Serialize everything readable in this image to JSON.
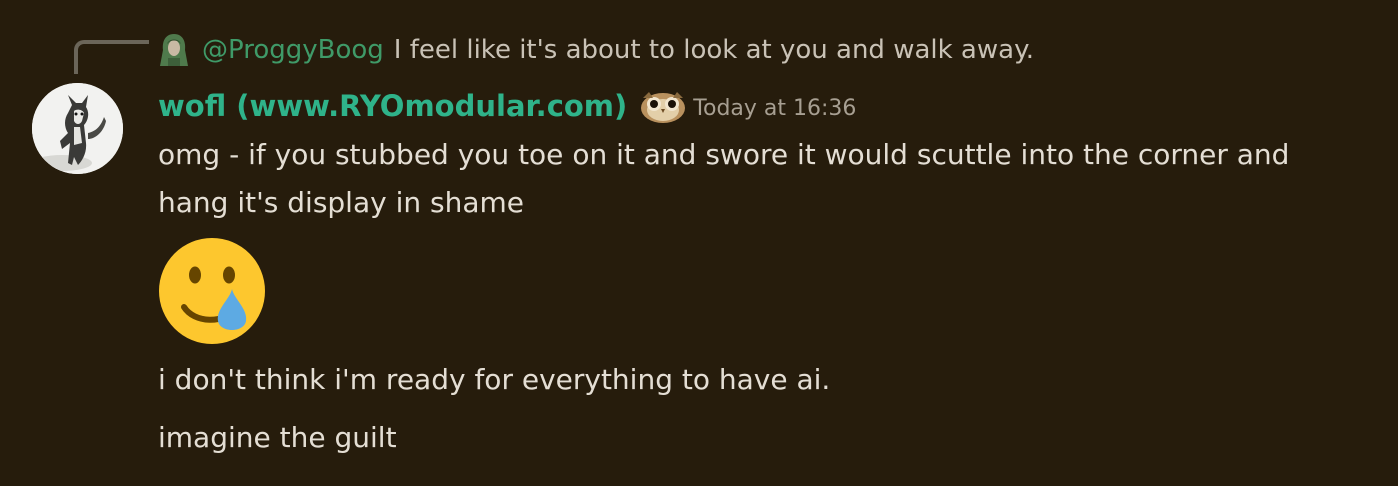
{
  "reply": {
    "author": "@ProggyBoog",
    "text": "I feel like it's about to look at you and walk away."
  },
  "message": {
    "username": "wofl (www.RYOmodular.com)",
    "timestamp": "Today at 16:36",
    "lines": [
      "omg - if you stubbed you toe on it and swore it would scuttle into the corner and hang it's display in shame",
      "i don't think i'm ready for everything to have ai.",
      "imagine the guilt"
    ],
    "emoji": "smiling-face-with-tear-icon"
  },
  "colors": {
    "background": "#261c0c",
    "username": "#2fb38a",
    "reply_author": "#3f9a68",
    "timestamp": "#a79f92",
    "text": "#e4ded4"
  }
}
